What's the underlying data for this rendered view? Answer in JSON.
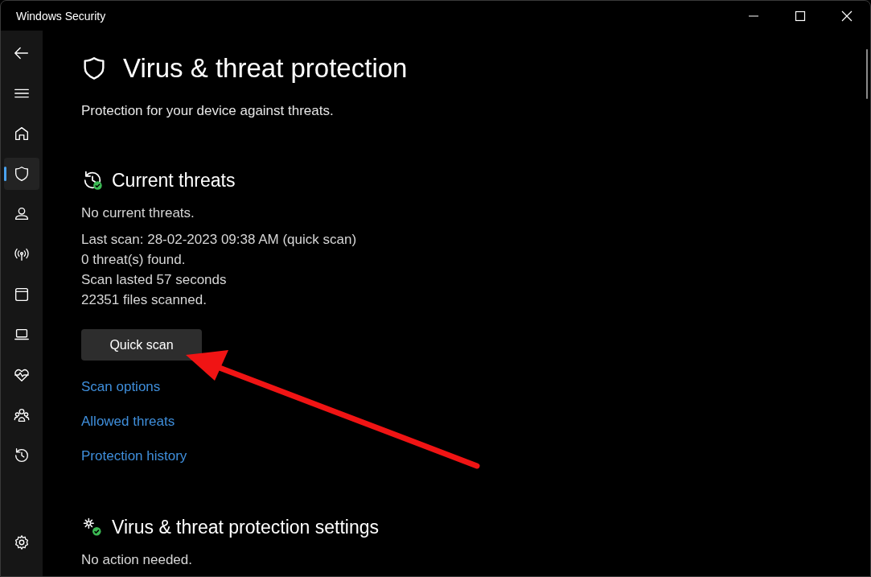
{
  "window": {
    "title": "Windows Security"
  },
  "sidebar": {
    "items": [
      {
        "selected": false
      },
      {
        "selected": false
      },
      {
        "selected": false
      },
      {
        "selected": true
      },
      {
        "selected": false
      },
      {
        "selected": false
      },
      {
        "selected": false
      },
      {
        "selected": false
      },
      {
        "selected": false
      },
      {
        "selected": false
      },
      {
        "selected": false
      },
      {
        "selected": false
      }
    ]
  },
  "page": {
    "title": "Virus & threat protection",
    "subtitle": "Protection for your device against threats."
  },
  "current_threats": {
    "heading": "Current threats",
    "lines": [
      "No current threats.",
      "Last scan: 28-02-2023 09:38 AM (quick scan)",
      "0 threat(s) found.",
      "Scan lasted 57 seconds",
      "22351 files scanned."
    ],
    "button": "Quick scan",
    "links": [
      "Scan options",
      "Allowed threats",
      "Protection history"
    ]
  },
  "settings_section": {
    "heading": "Virus & threat protection settings",
    "status": "No action needed."
  }
}
